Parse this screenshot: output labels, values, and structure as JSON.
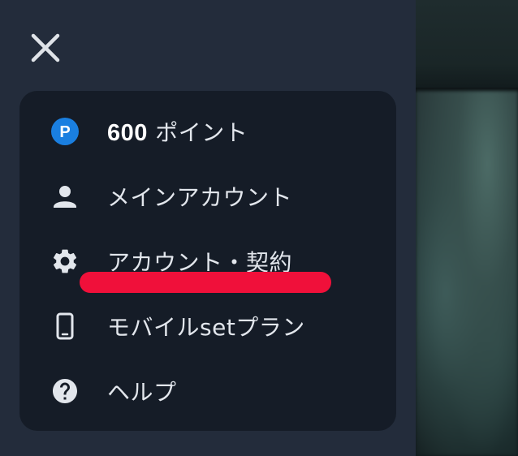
{
  "menu": {
    "items": [
      {
        "icon": "points-p-icon",
        "icon_text": "P",
        "value": "600",
        "label": " ポイント"
      },
      {
        "icon": "person-icon",
        "label": "メインアカウント"
      },
      {
        "icon": "gear-icon",
        "label": "アカウント・契約"
      },
      {
        "icon": "smartphone-icon",
        "label": "モバイルsetプラン"
      },
      {
        "icon": "help-circle-icon",
        "label": "ヘルプ"
      }
    ]
  },
  "colors": {
    "drawer_bg": "#232c3b",
    "card_bg": "#151c27",
    "text": "#e2e6ec",
    "points_badge": "#1a7fe0",
    "highlight": "#f0103a"
  }
}
